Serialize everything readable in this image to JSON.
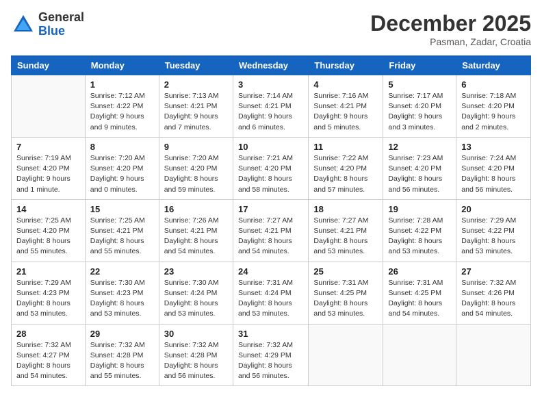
{
  "logo": {
    "general": "General",
    "blue": "Blue"
  },
  "title": "December 2025",
  "subtitle": "Pasman, Zadar, Croatia",
  "days_of_week": [
    "Sunday",
    "Monday",
    "Tuesday",
    "Wednesday",
    "Thursday",
    "Friday",
    "Saturday"
  ],
  "weeks": [
    [
      {
        "day": "",
        "info": ""
      },
      {
        "day": "1",
        "info": "Sunrise: 7:12 AM\nSunset: 4:22 PM\nDaylight: 9 hours\nand 9 minutes."
      },
      {
        "day": "2",
        "info": "Sunrise: 7:13 AM\nSunset: 4:21 PM\nDaylight: 9 hours\nand 7 minutes."
      },
      {
        "day": "3",
        "info": "Sunrise: 7:14 AM\nSunset: 4:21 PM\nDaylight: 9 hours\nand 6 minutes."
      },
      {
        "day": "4",
        "info": "Sunrise: 7:16 AM\nSunset: 4:21 PM\nDaylight: 9 hours\nand 5 minutes."
      },
      {
        "day": "5",
        "info": "Sunrise: 7:17 AM\nSunset: 4:20 PM\nDaylight: 9 hours\nand 3 minutes."
      },
      {
        "day": "6",
        "info": "Sunrise: 7:18 AM\nSunset: 4:20 PM\nDaylight: 9 hours\nand 2 minutes."
      }
    ],
    [
      {
        "day": "7",
        "info": "Sunrise: 7:19 AM\nSunset: 4:20 PM\nDaylight: 9 hours\nand 1 minute."
      },
      {
        "day": "8",
        "info": "Sunrise: 7:20 AM\nSunset: 4:20 PM\nDaylight: 9 hours\nand 0 minutes."
      },
      {
        "day": "9",
        "info": "Sunrise: 7:20 AM\nSunset: 4:20 PM\nDaylight: 8 hours\nand 59 minutes."
      },
      {
        "day": "10",
        "info": "Sunrise: 7:21 AM\nSunset: 4:20 PM\nDaylight: 8 hours\nand 58 minutes."
      },
      {
        "day": "11",
        "info": "Sunrise: 7:22 AM\nSunset: 4:20 PM\nDaylight: 8 hours\nand 57 minutes."
      },
      {
        "day": "12",
        "info": "Sunrise: 7:23 AM\nSunset: 4:20 PM\nDaylight: 8 hours\nand 56 minutes."
      },
      {
        "day": "13",
        "info": "Sunrise: 7:24 AM\nSunset: 4:20 PM\nDaylight: 8 hours\nand 56 minutes."
      }
    ],
    [
      {
        "day": "14",
        "info": "Sunrise: 7:25 AM\nSunset: 4:20 PM\nDaylight: 8 hours\nand 55 minutes."
      },
      {
        "day": "15",
        "info": "Sunrise: 7:25 AM\nSunset: 4:21 PM\nDaylight: 8 hours\nand 55 minutes."
      },
      {
        "day": "16",
        "info": "Sunrise: 7:26 AM\nSunset: 4:21 PM\nDaylight: 8 hours\nand 54 minutes."
      },
      {
        "day": "17",
        "info": "Sunrise: 7:27 AM\nSunset: 4:21 PM\nDaylight: 8 hours\nand 54 minutes."
      },
      {
        "day": "18",
        "info": "Sunrise: 7:27 AM\nSunset: 4:21 PM\nDaylight: 8 hours\nand 53 minutes."
      },
      {
        "day": "19",
        "info": "Sunrise: 7:28 AM\nSunset: 4:22 PM\nDaylight: 8 hours\nand 53 minutes."
      },
      {
        "day": "20",
        "info": "Sunrise: 7:29 AM\nSunset: 4:22 PM\nDaylight: 8 hours\nand 53 minutes."
      }
    ],
    [
      {
        "day": "21",
        "info": "Sunrise: 7:29 AM\nSunset: 4:23 PM\nDaylight: 8 hours\nand 53 minutes."
      },
      {
        "day": "22",
        "info": "Sunrise: 7:30 AM\nSunset: 4:23 PM\nDaylight: 8 hours\nand 53 minutes."
      },
      {
        "day": "23",
        "info": "Sunrise: 7:30 AM\nSunset: 4:24 PM\nDaylight: 8 hours\nand 53 minutes."
      },
      {
        "day": "24",
        "info": "Sunrise: 7:31 AM\nSunset: 4:24 PM\nDaylight: 8 hours\nand 53 minutes."
      },
      {
        "day": "25",
        "info": "Sunrise: 7:31 AM\nSunset: 4:25 PM\nDaylight: 8 hours\nand 53 minutes."
      },
      {
        "day": "26",
        "info": "Sunrise: 7:31 AM\nSunset: 4:25 PM\nDaylight: 8 hours\nand 54 minutes."
      },
      {
        "day": "27",
        "info": "Sunrise: 7:32 AM\nSunset: 4:26 PM\nDaylight: 8 hours\nand 54 minutes."
      }
    ],
    [
      {
        "day": "28",
        "info": "Sunrise: 7:32 AM\nSunset: 4:27 PM\nDaylight: 8 hours\nand 54 minutes."
      },
      {
        "day": "29",
        "info": "Sunrise: 7:32 AM\nSunset: 4:28 PM\nDaylight: 8 hours\nand 55 minutes."
      },
      {
        "day": "30",
        "info": "Sunrise: 7:32 AM\nSunset: 4:28 PM\nDaylight: 8 hours\nand 56 minutes."
      },
      {
        "day": "31",
        "info": "Sunrise: 7:32 AM\nSunset: 4:29 PM\nDaylight: 8 hours\nand 56 minutes."
      },
      {
        "day": "",
        "info": ""
      },
      {
        "day": "",
        "info": ""
      },
      {
        "day": "",
        "info": ""
      }
    ]
  ]
}
